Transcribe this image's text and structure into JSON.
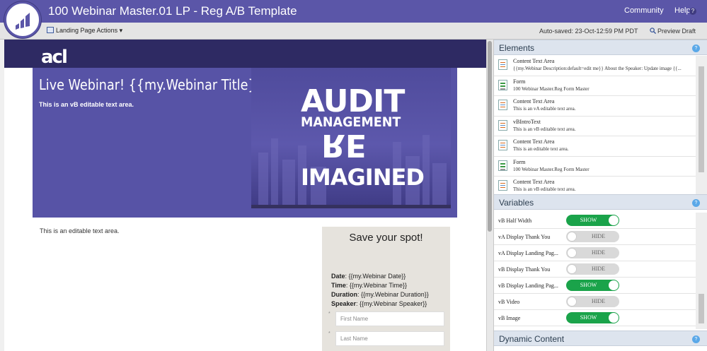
{
  "app": {
    "title": "100 Webinar Master.01 LP - Reg A/B Template",
    "community": "Community",
    "help": "Help",
    "help_icon": "?"
  },
  "toolbar": {
    "actions_label": "Landing Page Actions ▾",
    "autosaved": "Auto-saved: 23-Oct-12:59 PM PDT",
    "preview_label": "Preview Draft"
  },
  "page": {
    "logo_text": "acl",
    "hero_title": "Live Webinar! {{my.Webinar Title}}",
    "hero_subtitle": "This is an vB editable text area.",
    "image_words": [
      "AUDIT",
      "MANAGEMENT",
      "RE",
      "IMAGINED"
    ],
    "edit_text": "This is an editable text area.",
    "form": {
      "title": "Save your spot!",
      "lines": [
        {
          "label": "Date",
          "value": ": {{my.Webinar Date}}"
        },
        {
          "label": "Time",
          "value": ": {{my.Webinar Time}}"
        },
        {
          "label": "Duration",
          "value": ": {{my.Webinar Duration}}"
        },
        {
          "label": "Speaker",
          "value": ": {{my.Webinar Speaker}}"
        }
      ],
      "first_name_placeholder": "First Name",
      "last_name_placeholder": "Last Name",
      "required_mark": "*"
    }
  },
  "panel": {
    "elements_header": "Elements",
    "variables_header": "Variables",
    "dynamic_header": "Dynamic Content",
    "toggle_icon": "?",
    "elements": [
      {
        "type": "text",
        "title": "Content Text Area",
        "desc": "{{my.Webinar Description:default=edit me}} About the Speaker: Update image {{..."
      },
      {
        "type": "form",
        "title": "Form",
        "desc": "100 Webinar Master.Reg Form Master"
      },
      {
        "type": "text",
        "title": "Content Text Area",
        "desc": "This is an vA editable text area."
      },
      {
        "type": "text",
        "title": "vBIntroText",
        "desc": "This is an vB editable text area."
      },
      {
        "type": "text",
        "title": "Content Text Area",
        "desc": "This is an editable text area."
      },
      {
        "type": "form",
        "title": "Form",
        "desc": "100 Webinar Master.Reg Form Master"
      },
      {
        "type": "text",
        "title": "Content Text Area",
        "desc": "This is an vB editable text area."
      }
    ],
    "variables": [
      {
        "name": "vB Half Width",
        "state": "SHOW",
        "on": true
      },
      {
        "name": "vA Display Thank You",
        "state": "HIDE",
        "on": false
      },
      {
        "name": "vA Display Landing Pag...",
        "state": "HIDE",
        "on": false
      },
      {
        "name": "vB Display Thank You",
        "state": "HIDE",
        "on": false
      },
      {
        "name": "vB Display Landing Pag...",
        "state": "SHOW",
        "on": true
      },
      {
        "name": "vB Video",
        "state": "HIDE",
        "on": false
      },
      {
        "name": "vB Image",
        "state": "SHOW",
        "on": true
      }
    ]
  },
  "colors": {
    "brand_purple": "#5b56a8",
    "site_header": "#2e2a63",
    "toggle_on": "#1aa34a",
    "panel_header": "#dde4ee"
  }
}
